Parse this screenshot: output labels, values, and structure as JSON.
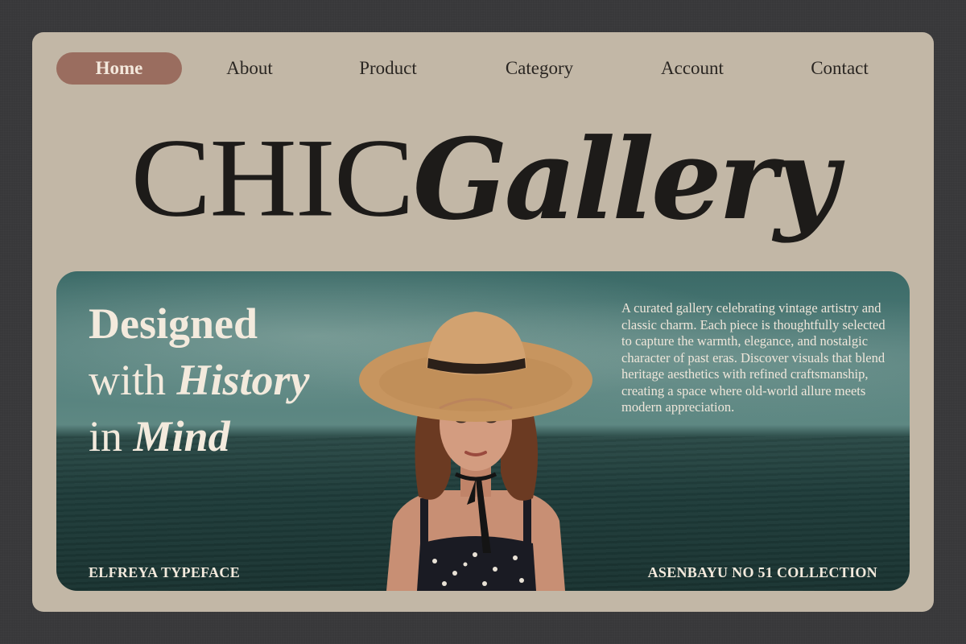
{
  "nav": {
    "items": [
      {
        "label": "Home",
        "active": true
      },
      {
        "label": "About",
        "active": false
      },
      {
        "label": "Product",
        "active": false
      },
      {
        "label": "Category",
        "active": false
      },
      {
        "label": "Account",
        "active": false
      },
      {
        "label": "Contact",
        "active": false
      }
    ]
  },
  "headline": {
    "part1": "CHIC",
    "part2": "Gallery"
  },
  "hero": {
    "title_line1": "Designed",
    "title_line2_plain": "with ",
    "title_line2_emph": "History",
    "title_line3_plain": "in ",
    "title_line3_emph": "Mind",
    "description": "A curated gallery celebrating vintage artistry and classic charm. Each piece is thoughtfully selected to capture the warmth, elegance, and nostalgic character of past eras. Discover visuals that blend heritage aesthetics with refined craftsmanship, creating a space where old-world allure meets modern appreciation.",
    "footer_left": "ELFREYA TYPEFACE",
    "footer_right": "ASENBAYU NO 51 COLLECTION"
  },
  "colors": {
    "page_bg": "#38383a",
    "card_bg": "#c2b7a6",
    "nav_active_bg": "#9a6d5f",
    "hero_teal": "#3b6a67",
    "text_dark": "#1d1b19",
    "text_light": "#f3eadd"
  }
}
